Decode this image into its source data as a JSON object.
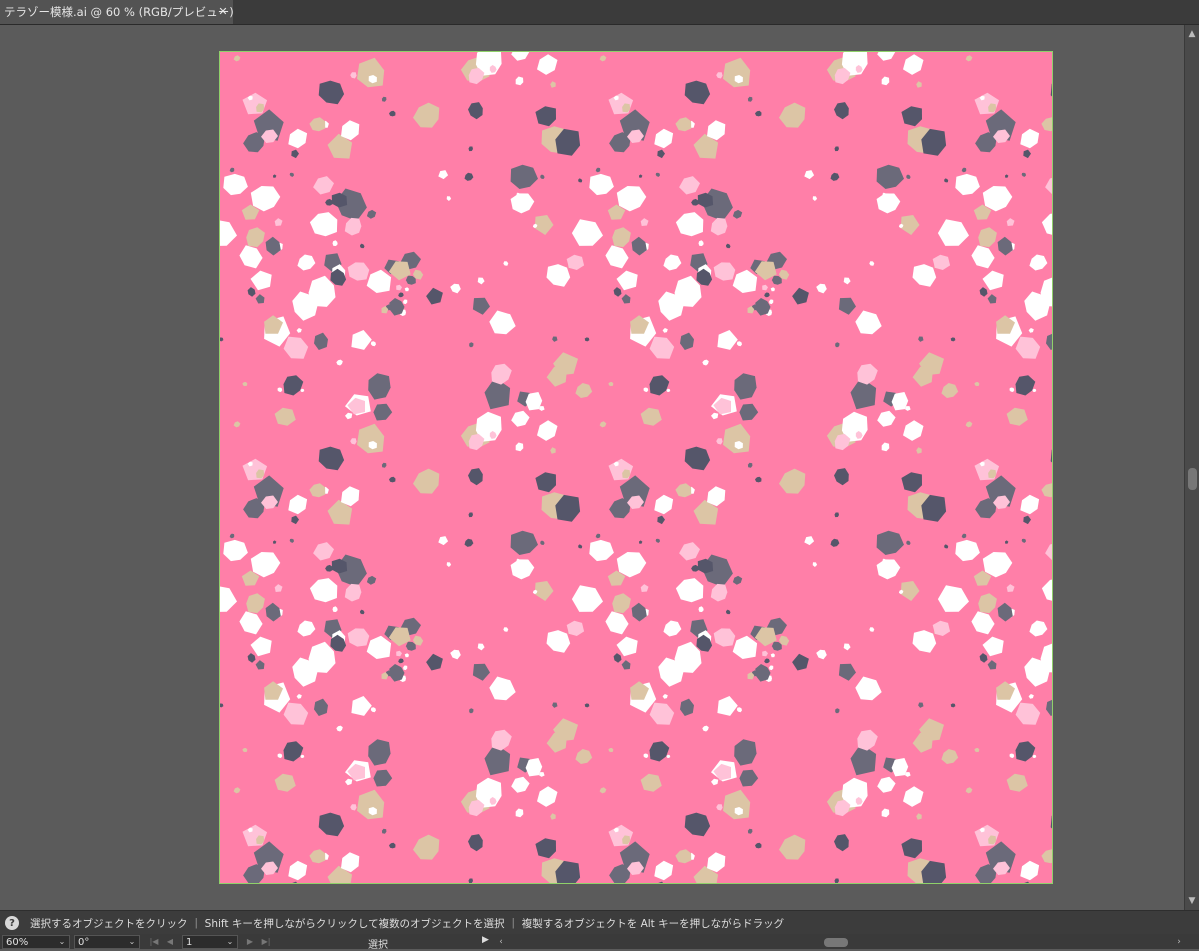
{
  "document_tab": {
    "title": "テラゾー模様.ai @ 60 % (RGB/プレビュー)",
    "close_icon": "close-icon"
  },
  "artboard": {
    "background_color": "#ff7fa8",
    "border_color": "#8fd16a",
    "palette": {
      "white": "#ffffff",
      "light_pink": "#ffc2d8",
      "beige": "#dcc5a5",
      "gray": "#6b6a7a",
      "dark": "#55566a"
    }
  },
  "hint_bar": {
    "help_icon": "help-icon",
    "text": "選択するオブジェクトをクリック ｜ Shift キーを押しながらクリックして複数のオブジェクトを選択 ｜ 複製するオブジェクトを Alt キーを押しながらドラッグ"
  },
  "status_bar": {
    "zoom": "60%",
    "rotation": "0°",
    "artboard_number": "1",
    "current_tool": "選択"
  }
}
